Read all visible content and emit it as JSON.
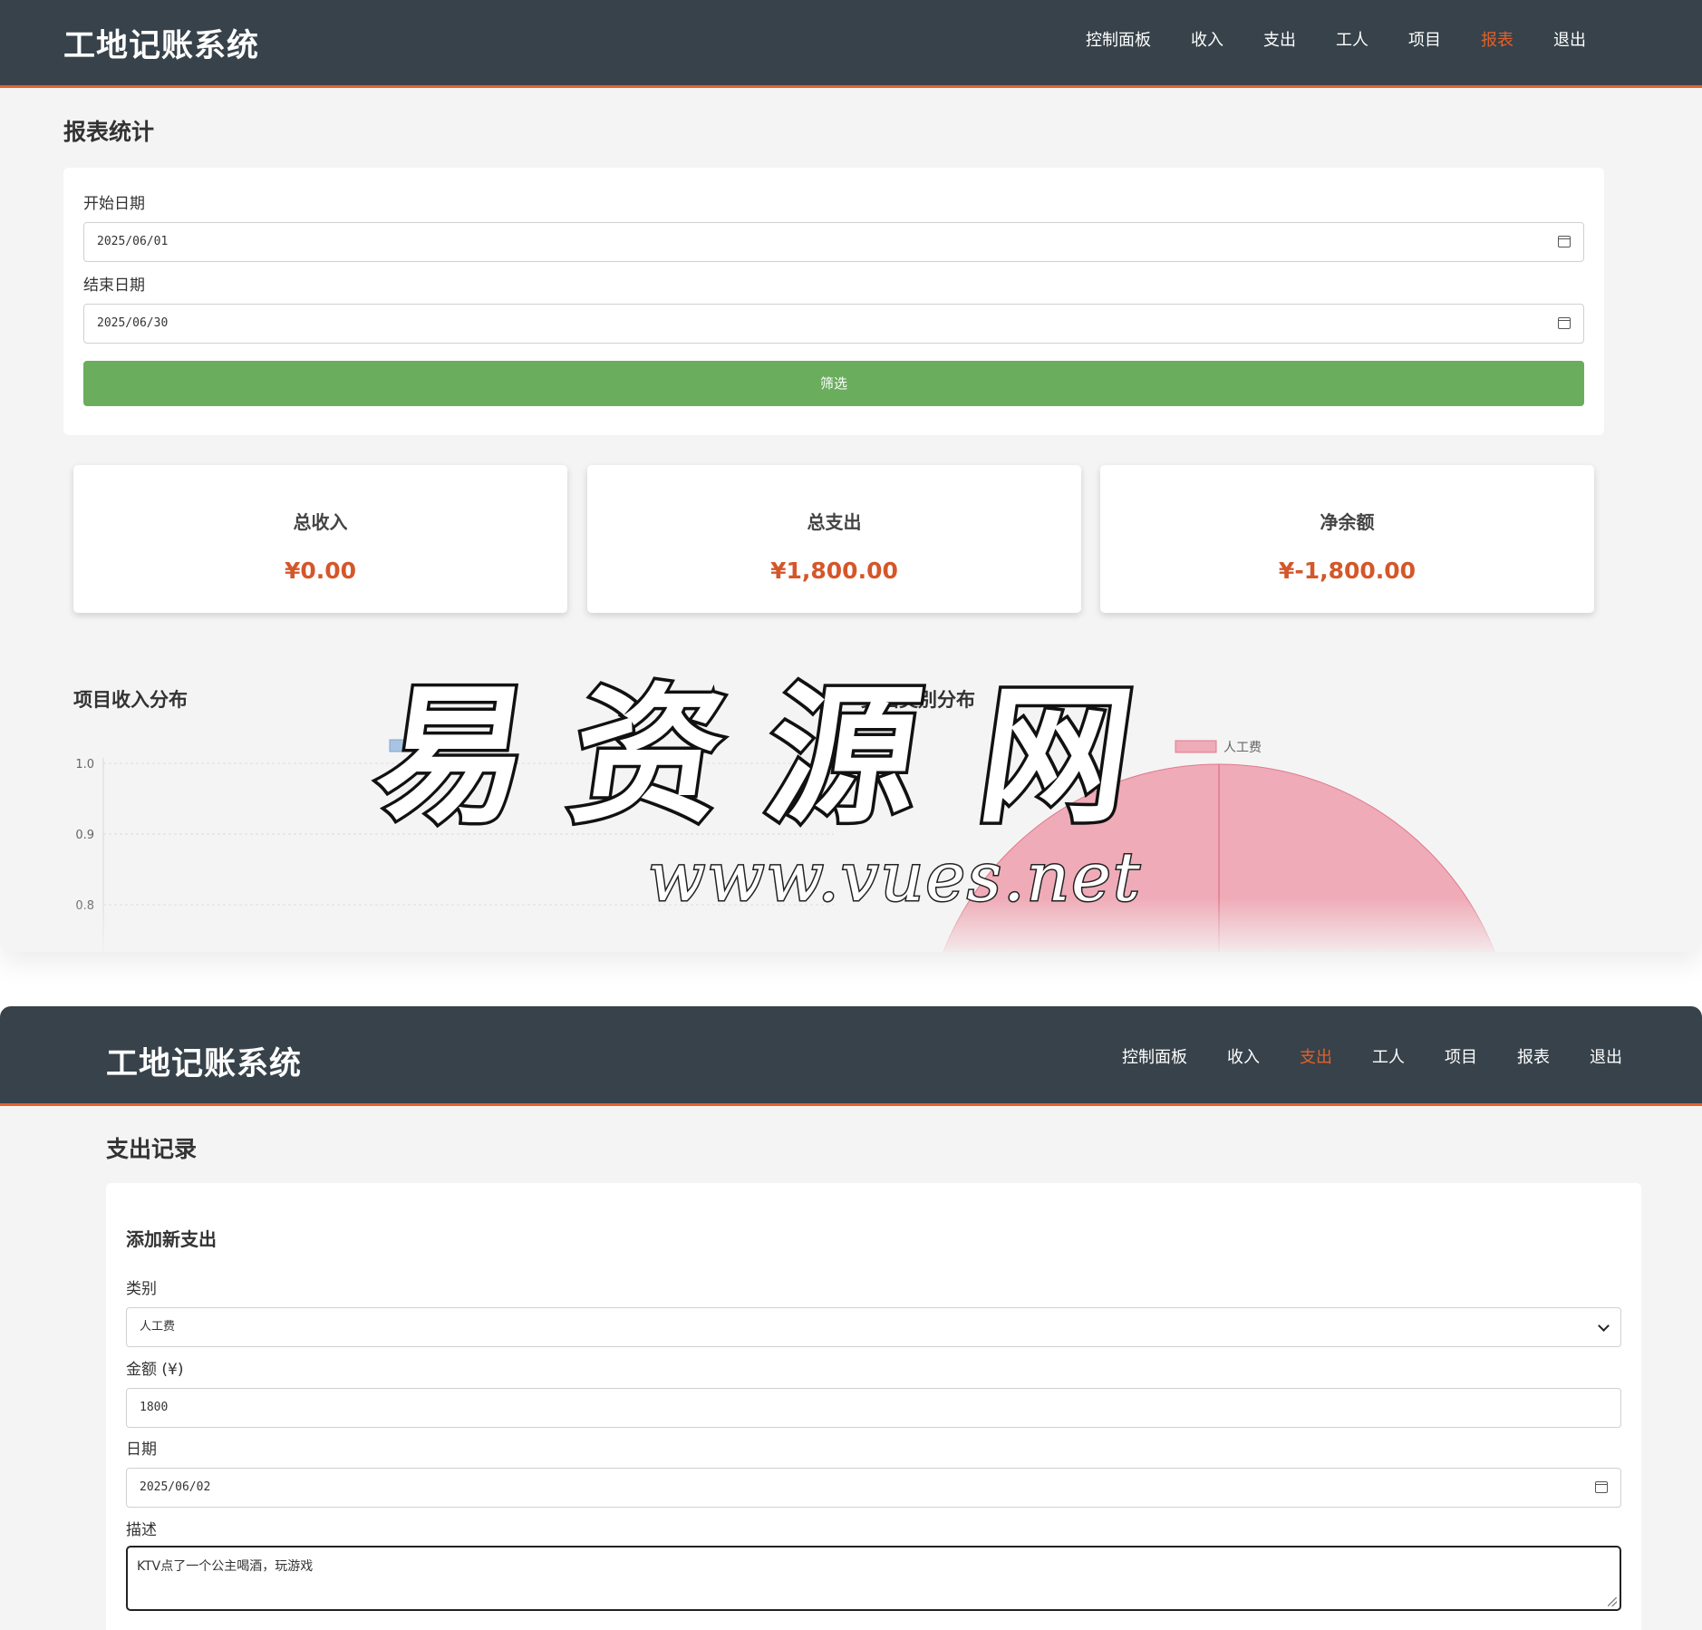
{
  "report_screen": {
    "brand": "工地记账系统",
    "nav": [
      {
        "label": "控制面板",
        "active": false
      },
      {
        "label": "收入",
        "active": false
      },
      {
        "label": "支出",
        "active": false
      },
      {
        "label": "工人",
        "active": false
      },
      {
        "label": "项目",
        "active": false
      },
      {
        "label": "报表",
        "active": true
      },
      {
        "label": "退出",
        "active": false
      }
    ],
    "page_title": "报表统计",
    "filter": {
      "start_label": "开始日期",
      "start_value": "2025/06/01",
      "end_label": "结束日期",
      "end_value": "2025/06/30",
      "button_label": "筛选"
    },
    "stats": [
      {
        "label": "总收入",
        "value": "¥0.00"
      },
      {
        "label": "总支出",
        "value": "¥1,800.00"
      },
      {
        "label": "净余额",
        "value": "¥-1,800.00"
      }
    ],
    "income_chart_title": "项目收入分布",
    "expense_chart_title": "支出类别分布"
  },
  "chart_data": [
    {
      "type": "bar",
      "title": "项目收入分布",
      "categories": [],
      "series": [],
      "yticks": [
        "1.0",
        "0.9",
        "0.8"
      ],
      "grid": true,
      "legend": "top",
      "colors": {
        "legend_swatch": "#a8c4e3"
      }
    },
    {
      "type": "pie",
      "title": "支出类别分布",
      "labels": [
        "人工费"
      ],
      "values": [
        1800
      ],
      "legend": "top",
      "colors": {
        "人工费": "#efabb7",
        "border": "#e07a8d"
      }
    }
  ],
  "expense_screen": {
    "brand": "工地记账系统",
    "nav": [
      {
        "label": "控制面板",
        "active": false
      },
      {
        "label": "收入",
        "active": false
      },
      {
        "label": "支出",
        "active": true
      },
      {
        "label": "工人",
        "active": false
      },
      {
        "label": "项目",
        "active": false
      },
      {
        "label": "报表",
        "active": false
      },
      {
        "label": "退出",
        "active": false
      }
    ],
    "page_title": "支出记录",
    "form": {
      "heading": "添加新支出",
      "category_label": "类别",
      "category_value": "人工费",
      "amount_label": "金额 (¥)",
      "amount_value": "1800",
      "date_label": "日期",
      "date_value": "2025/06/02",
      "description_label": "描述",
      "description_value": "KTV点了一个公主喝酒，玩游戏"
    }
  },
  "watermark": {
    "text": "易资源网",
    "url": "www.vues.net"
  },
  "colors": {
    "navbar": "#37424a",
    "accent": "#e0622b",
    "button_green": "#6aad5d",
    "value_red": "#d4572a"
  }
}
